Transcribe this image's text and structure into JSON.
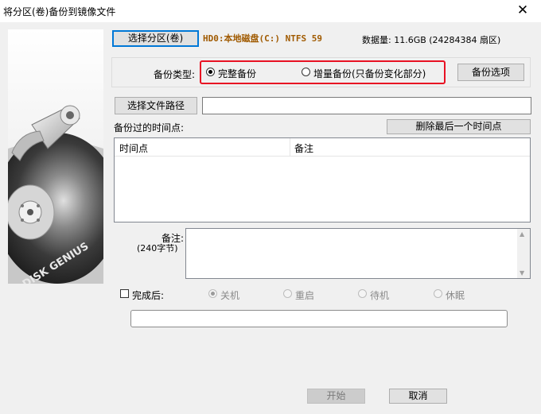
{
  "window": {
    "title": "将分区(卷)备份到镜像文件",
    "close_glyph": "✕"
  },
  "image_panel": {
    "brand": "DISK GENIUS"
  },
  "partition": {
    "select_button": "选择分区(卷)",
    "selected": "HD0:本地磁盘(C:) NTFS 59",
    "data_amount": "数据量: 11.6GB (24284384 扇区)"
  },
  "backup_type": {
    "label": "备份类型:",
    "options": [
      {
        "label": "完整备份",
        "checked": true
      },
      {
        "label": "增量备份(只备份变化部分)",
        "checked": false
      }
    ],
    "options_button": "备份选项",
    "highlight_color": "#e81123"
  },
  "file_path": {
    "select_button": "选择文件路径",
    "value": ""
  },
  "timepoints": {
    "label": "备份过的时间点:",
    "delete_button": "删除最后一个时间点",
    "columns": [
      "时间点",
      "备注"
    ],
    "rows": []
  },
  "note": {
    "label": "备注:",
    "hint": "(240字节)",
    "value": ""
  },
  "after_completion": {
    "label": "完成后:",
    "checked": false,
    "options": [
      {
        "label": "关机",
        "checked": true
      },
      {
        "label": "重启",
        "checked": false
      },
      {
        "label": "待机",
        "checked": false
      },
      {
        "label": "休眠",
        "checked": false
      }
    ]
  },
  "progress": {
    "value": 0
  },
  "footer": {
    "start_button": "开始",
    "cancel_button": "取消"
  }
}
